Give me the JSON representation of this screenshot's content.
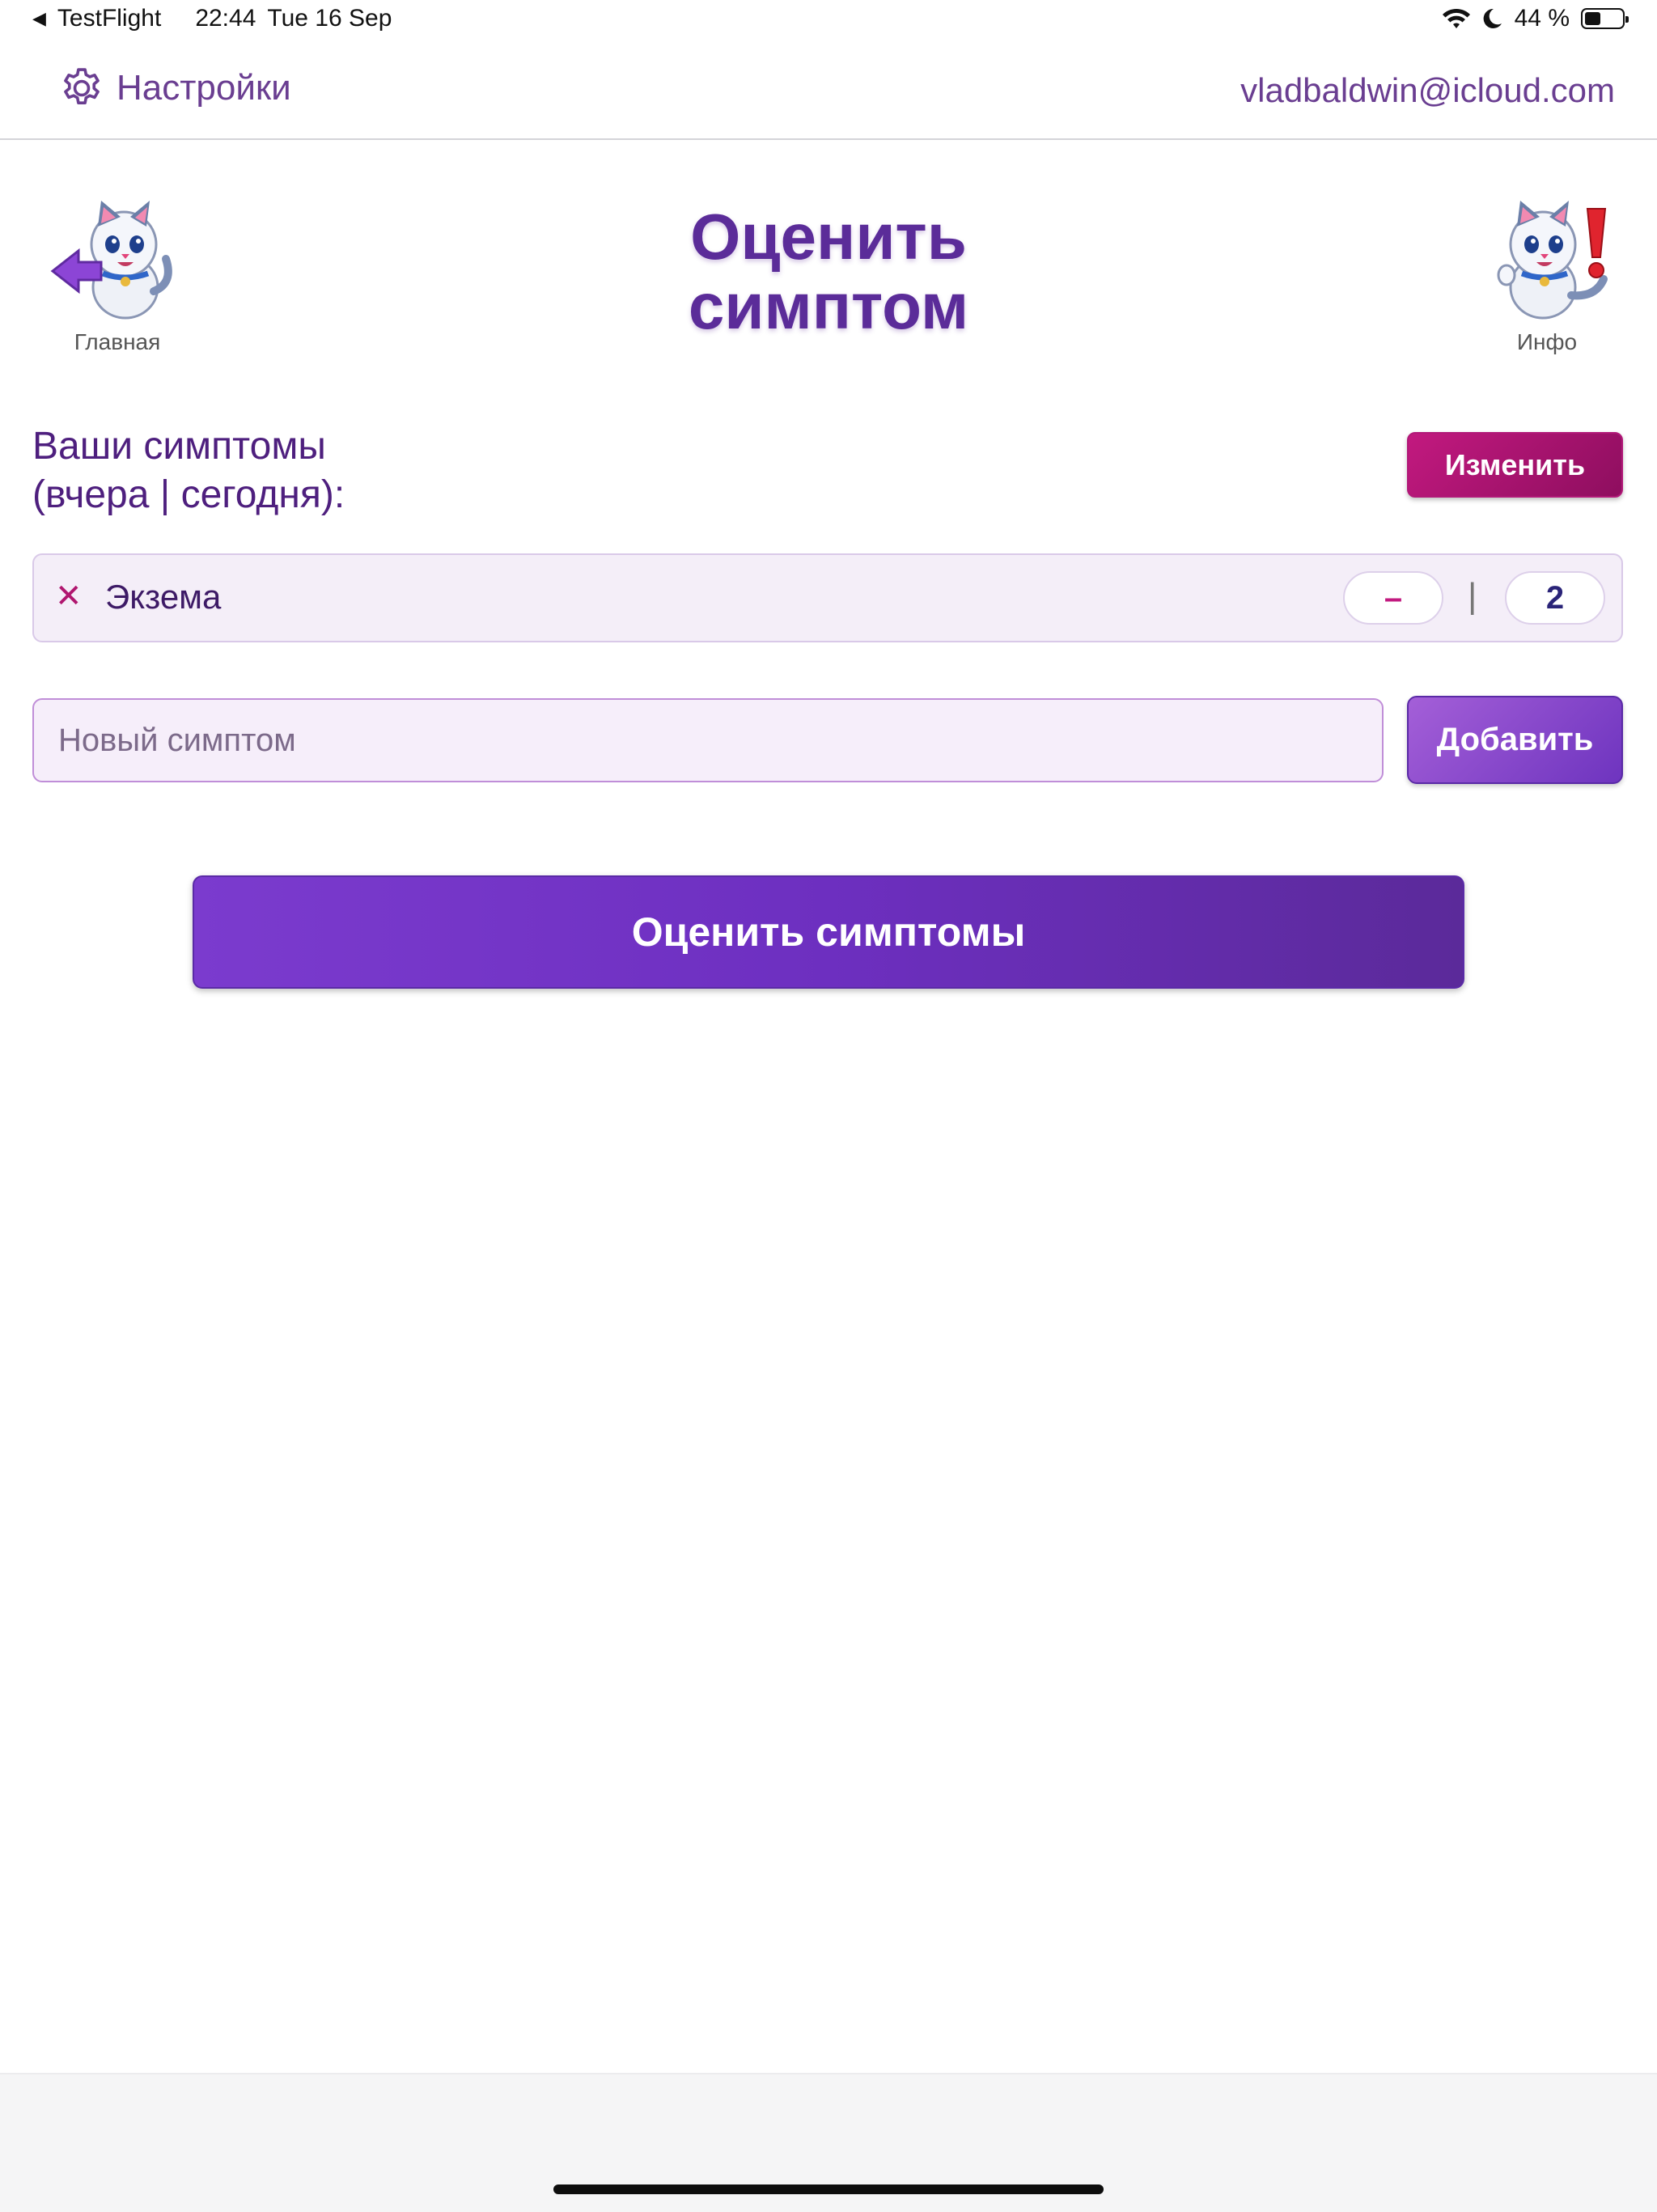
{
  "status_bar": {
    "back_app": "TestFlight",
    "time": "22:44",
    "date": "Tue 16 Sep",
    "battery_percent": "44 %",
    "battery_level": 0.44
  },
  "top_nav": {
    "settings_label": "Настройки",
    "account_email": "vladbaldwin@icloud.com"
  },
  "header": {
    "title_line1": "Оценить",
    "title_line2": "симптом",
    "home_label": "Главная",
    "info_label": "Инфо"
  },
  "symptoms_section": {
    "title_line1": "Ваши симптомы",
    "title_line2": "(вчера | сегодня):",
    "change_button": "Изменить",
    "items": [
      {
        "name": "Экзема",
        "yesterday": "–",
        "separator": "|",
        "today": "2"
      }
    ]
  },
  "new_symptom": {
    "placeholder": "Новый симптом",
    "value": "",
    "add_button": "Добавить"
  },
  "rate_button": "Оценить симптомы",
  "colors": {
    "primary_purple": "#6d2fc0",
    "title_purple": "#5b2c99",
    "magenta": "#c2197f",
    "row_bg": "#f4eef8"
  }
}
